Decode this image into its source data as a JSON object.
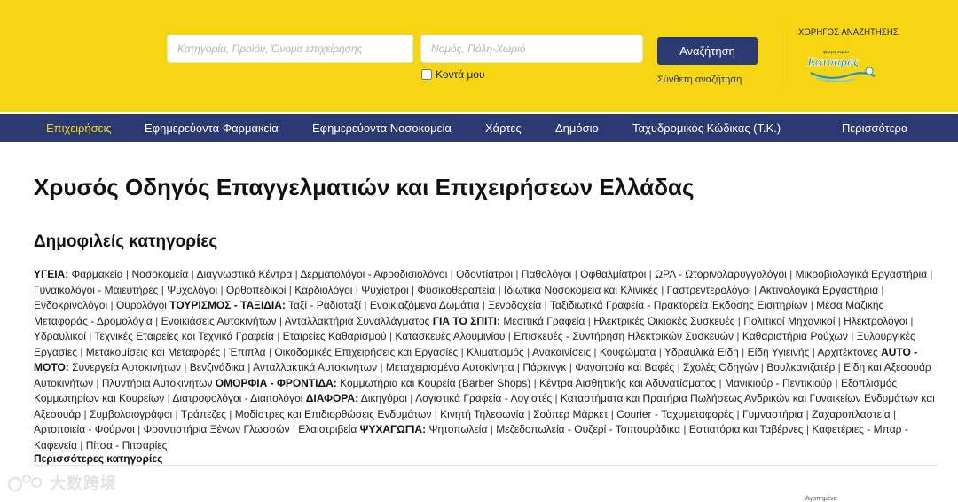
{
  "search": {
    "what_placeholder": "Κατηγορία, Προϊόν, Όνομα επιχείρησης",
    "where_placeholder": "Νομός, Πόλη-Χωριό",
    "nearby_label": "Κοντά μου",
    "button_label": "Αναζήτηση",
    "advanced_link": "Σύνθετη αναζήτηση"
  },
  "sponsor": {
    "label": "ΧΟΡΗΓΟΣ ΑΝΑΖΗΤΗΣΗΣ",
    "logo_text": "Κατσαρός",
    "logo_small_text": "φίλτρο νερού"
  },
  "nav": {
    "items": [
      {
        "label": "Επιχειρήσεις",
        "active": true
      },
      {
        "label": "Εφημερεύοντα Φαρμακεία"
      },
      {
        "label": "Εφημερεύοντα Νοσοκομεία"
      },
      {
        "label": "Χάρτες"
      },
      {
        "label": "Δημόσιο"
      },
      {
        "label": "Ταχυδρομικός Κώδικας (Τ.Κ.)"
      },
      {
        "label": "Περισσότερα"
      }
    ]
  },
  "page": {
    "title": "Χρυσός Οδηγός Επαγγελματιών και Επιχειρήσεων Ελλάδας",
    "popular_title": "Δημοφιλείς κατηγορίες",
    "more_categories": "Περισσότερες κατηγορίες"
  },
  "categories": [
    {
      "heading": "ΥΓΕΙΑ:",
      "items": [
        "Φαρμακεία",
        "Νοσοκομεία",
        "Διαγνωστικά Κέντρα",
        "Δερματολόγοι - Αφροδισιολόγοι",
        "Οδοντίατροι",
        "Παθολόγοι",
        "Οφθαλμίατροι",
        "ΩΡΛ - Ωτορινολαρυγγολόγοι",
        "Μικροβιολογικά Εργαστήρια",
        "Γυναικολόγοι - Μαιευτήρες",
        "Ψυχολόγοι",
        "Ορθοπεδικοί",
        "Καρδιολόγοι",
        "Ψυχίατροι",
        "Φυσικοθεραπεία",
        "Ιδιωτικά Νοσοκομεία και Κλινικές",
        "Γαστρεντερολόγοι",
        "Ακτινολογικά Εργαστήρια",
        "Ενδοκρινολόγοι",
        "Ουρολόγοι"
      ]
    },
    {
      "heading": "ΤΟΥΡΙΣΜΟΣ - ΤΑΞΙΔΙΑ:",
      "items": [
        "Ταξί - Ραδιοταξί",
        "Ενοικιαζόμενα Δωμάτια",
        "Ξενοδοχεία",
        "Ταξιδιωτικά Γραφεία - Πρακτορεία Έκδοσης Εισιτηρίων",
        "Μέσα Μαζικής Μεταφοράς - Δρομολόγια",
        "Ενοικιάσεις Αυτοκινήτων",
        "Ανταλλακτήρια Συναλλάγματος"
      ]
    },
    {
      "heading": "ΓΙΑ ΤΟ ΣΠΙΤΙ:",
      "items": [
        "Μεσιτικά Γραφεία",
        "Ηλεκτρικές Οικιακές Συσκευές",
        "Πολιτικοί Μηχανικοί",
        "Ηλεκτρολόγοι",
        "Υδραυλικοί",
        "Τεχνικές Εταιρείες και Τεχνικά Γραφεία",
        "Εταιρείες Καθαρισμού",
        "Κατασκευές Αλουμινίου",
        "Επισκευές - Συντήρηση Ηλεκτρικών Συσκευών",
        "Καθαριστήρια Ρούχων",
        "Ξυλουργικές Εργασίες",
        "Μετακομίσεις και Μεταφορές",
        "Έπιπλα",
        "Οικοδομικές Επιχειρήσεις και Εργασίες",
        "Κλιματισμός",
        "Ανακαινίσεις",
        "Κουφώματα",
        "Υδραυλικά Είδη",
        "Είδη Υγιεινής",
        "Αρχιτέκτονες"
      ]
    },
    {
      "heading": "AUTO - MOTO:",
      "items": [
        "Συνεργεία Αυτοκινήτων",
        "Βενζινάδικα",
        "Ανταλλακτικά Αυτοκινήτων",
        "Μεταχειρισμένα Αυτοκίνητα",
        "Πάρκινγκ",
        "Φανοποιία και Βαφές",
        "Σχολές Οδηγών",
        "Βουλκανιζατέρ",
        "Είδη και Αξεσουάρ Αυτοκινήτων",
        "Πλυντήρια Αυτοκινήτων"
      ]
    },
    {
      "heading": "ΟΜΟΡΦΙΑ - ΦΡΟΝΤΙΔΑ:",
      "items": [
        "Κομμωτήρια και Κουρεία (Barber Shops)",
        "Κέντρα Αισθητικής και Αδυνατίσματος",
        "Μανικιούρ - Πεντικιούρ",
        "Εξοπλισμός Κομμωτηρίων και Κουρείων",
        "Διατροφολόγοι - Διαιτολόγοι"
      ]
    },
    {
      "heading": "ΔΙΑΦΟΡΑ:",
      "items": [
        "Δικηγόροι",
        "Λογιστικά Γραφεία - Λογιστές",
        "Καταστήματα και Πρατήρια Πωλήσεως Ανδρικών και Γυναικείων Ενδυμάτων και Αξεσουάρ",
        "Συμβολαιογράφοι",
        "Τράπεζες",
        "Μοδίστρες και Επιδιορθώσεις Ενδυμάτων",
        "Κινητή Τηλεφωνία",
        "Σούπερ Μάρκετ",
        "Courier - Ταχυμεταφορές",
        "Γυμναστήρια",
        "Ζαχαροπλαστεία",
        "Αρτοποιεία - Φούρνοι",
        "Φροντιστήρια Ξένων Γλωσσών",
        "Ελαιοτριβεία"
      ]
    },
    {
      "heading": "ΨΥΧΑΓΩΓΙΑ:",
      "items": [
        "Ψητοπωλεία",
        "Μεζεδοπωλεία - Ουζερί - Τσιπουράδικα",
        "Εστιατόρια και Ταβέρνες",
        "Καφετέριες - Μπαρ - Καφενεία",
        "Πίτσα - Πιτσαρίες"
      ]
    }
  ],
  "underlined_item": "Οικοδομικές Επιχειρήσεις και Εργασίες",
  "watermark": {
    "text": "大数跨境"
  },
  "footer_tiny": "Αγαπημένα",
  "colors": {
    "header_yellow": "#f6d512",
    "nav_blue": "#2c3a73",
    "active_nav": "#f6d512"
  }
}
